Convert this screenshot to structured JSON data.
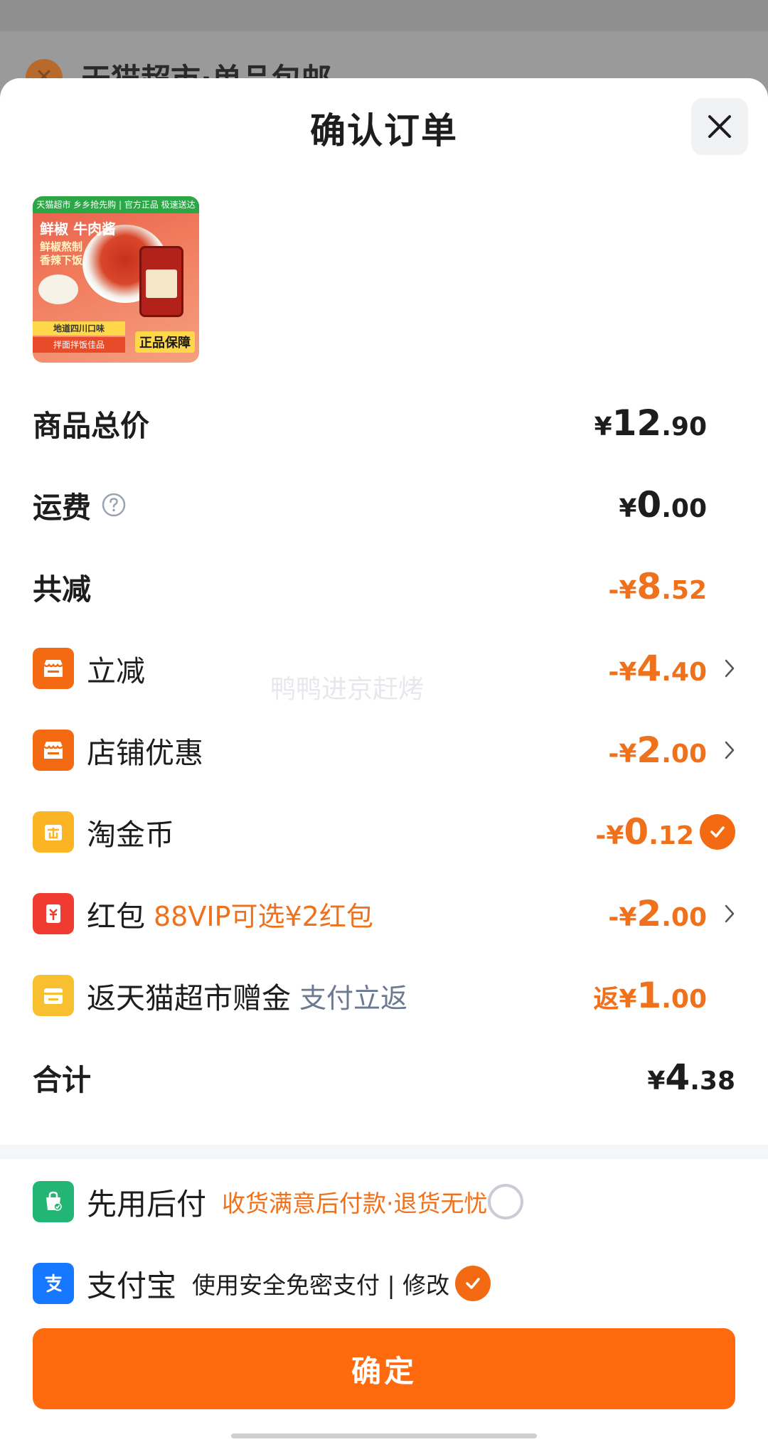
{
  "background": {
    "text": "天猫超市·单品包邮"
  },
  "header": {
    "title": "确认订单"
  },
  "product": {
    "image_banner": "天猫超市 乡乡抢先购 | 官方正品 极速送达",
    "image_title": "鲜椒 牛肉酱",
    "image_subtitle_1": "鲜椒熬制",
    "image_subtitle_2": "香辣下饭",
    "image_badge_1": "地道四川口味",
    "image_badge_2": "拌面拌饭佳品",
    "image_guarantee": "正品保障"
  },
  "summary": {
    "goods_total": {
      "label": "商品总价",
      "cur": "¥",
      "int": "12",
      "dec": ".90"
    },
    "shipping": {
      "label": "运费",
      "cur": "¥",
      "int": "0",
      "dec": ".00"
    },
    "total_discount": {
      "label": "共减",
      "cur": "-¥",
      "int": "8",
      "dec": ".52"
    }
  },
  "discounts": [
    {
      "label": "立减",
      "note": "",
      "cur": "-¥",
      "int": "4",
      "dec": ".40"
    },
    {
      "label": "店铺优惠",
      "note": "",
      "cur": "-¥",
      "int": "2",
      "dec": ".00"
    },
    {
      "label": "淘金币",
      "note": "",
      "cur": "-¥",
      "int": "0",
      "dec": ".12"
    },
    {
      "label": "红包",
      "note": "88VIP可选¥2红包",
      "cur": "-¥",
      "int": "2",
      "dec": ".00"
    },
    {
      "label": "返天猫超市赠金",
      "note": "支付立返",
      "cur": "返¥",
      "int": "1",
      "dec": ".00"
    }
  ],
  "total": {
    "label": "合计",
    "cur": "¥",
    "int": "4",
    "dec": ".38"
  },
  "payment": {
    "pay_later": {
      "label": "先用后付",
      "note": "收货满意后付款·退货无忧"
    },
    "alipay": {
      "label": "支付宝",
      "note": "使用安全免密支付 | 修改"
    }
  },
  "confirm_label": "确定",
  "watermark": "鸭鸭进京赶烤",
  "colors": {
    "accent_orange": "#f36a12",
    "button_orange": "#ff6a0f",
    "alipay_blue": "#1677ff",
    "pay_later_green": "#22b573"
  }
}
